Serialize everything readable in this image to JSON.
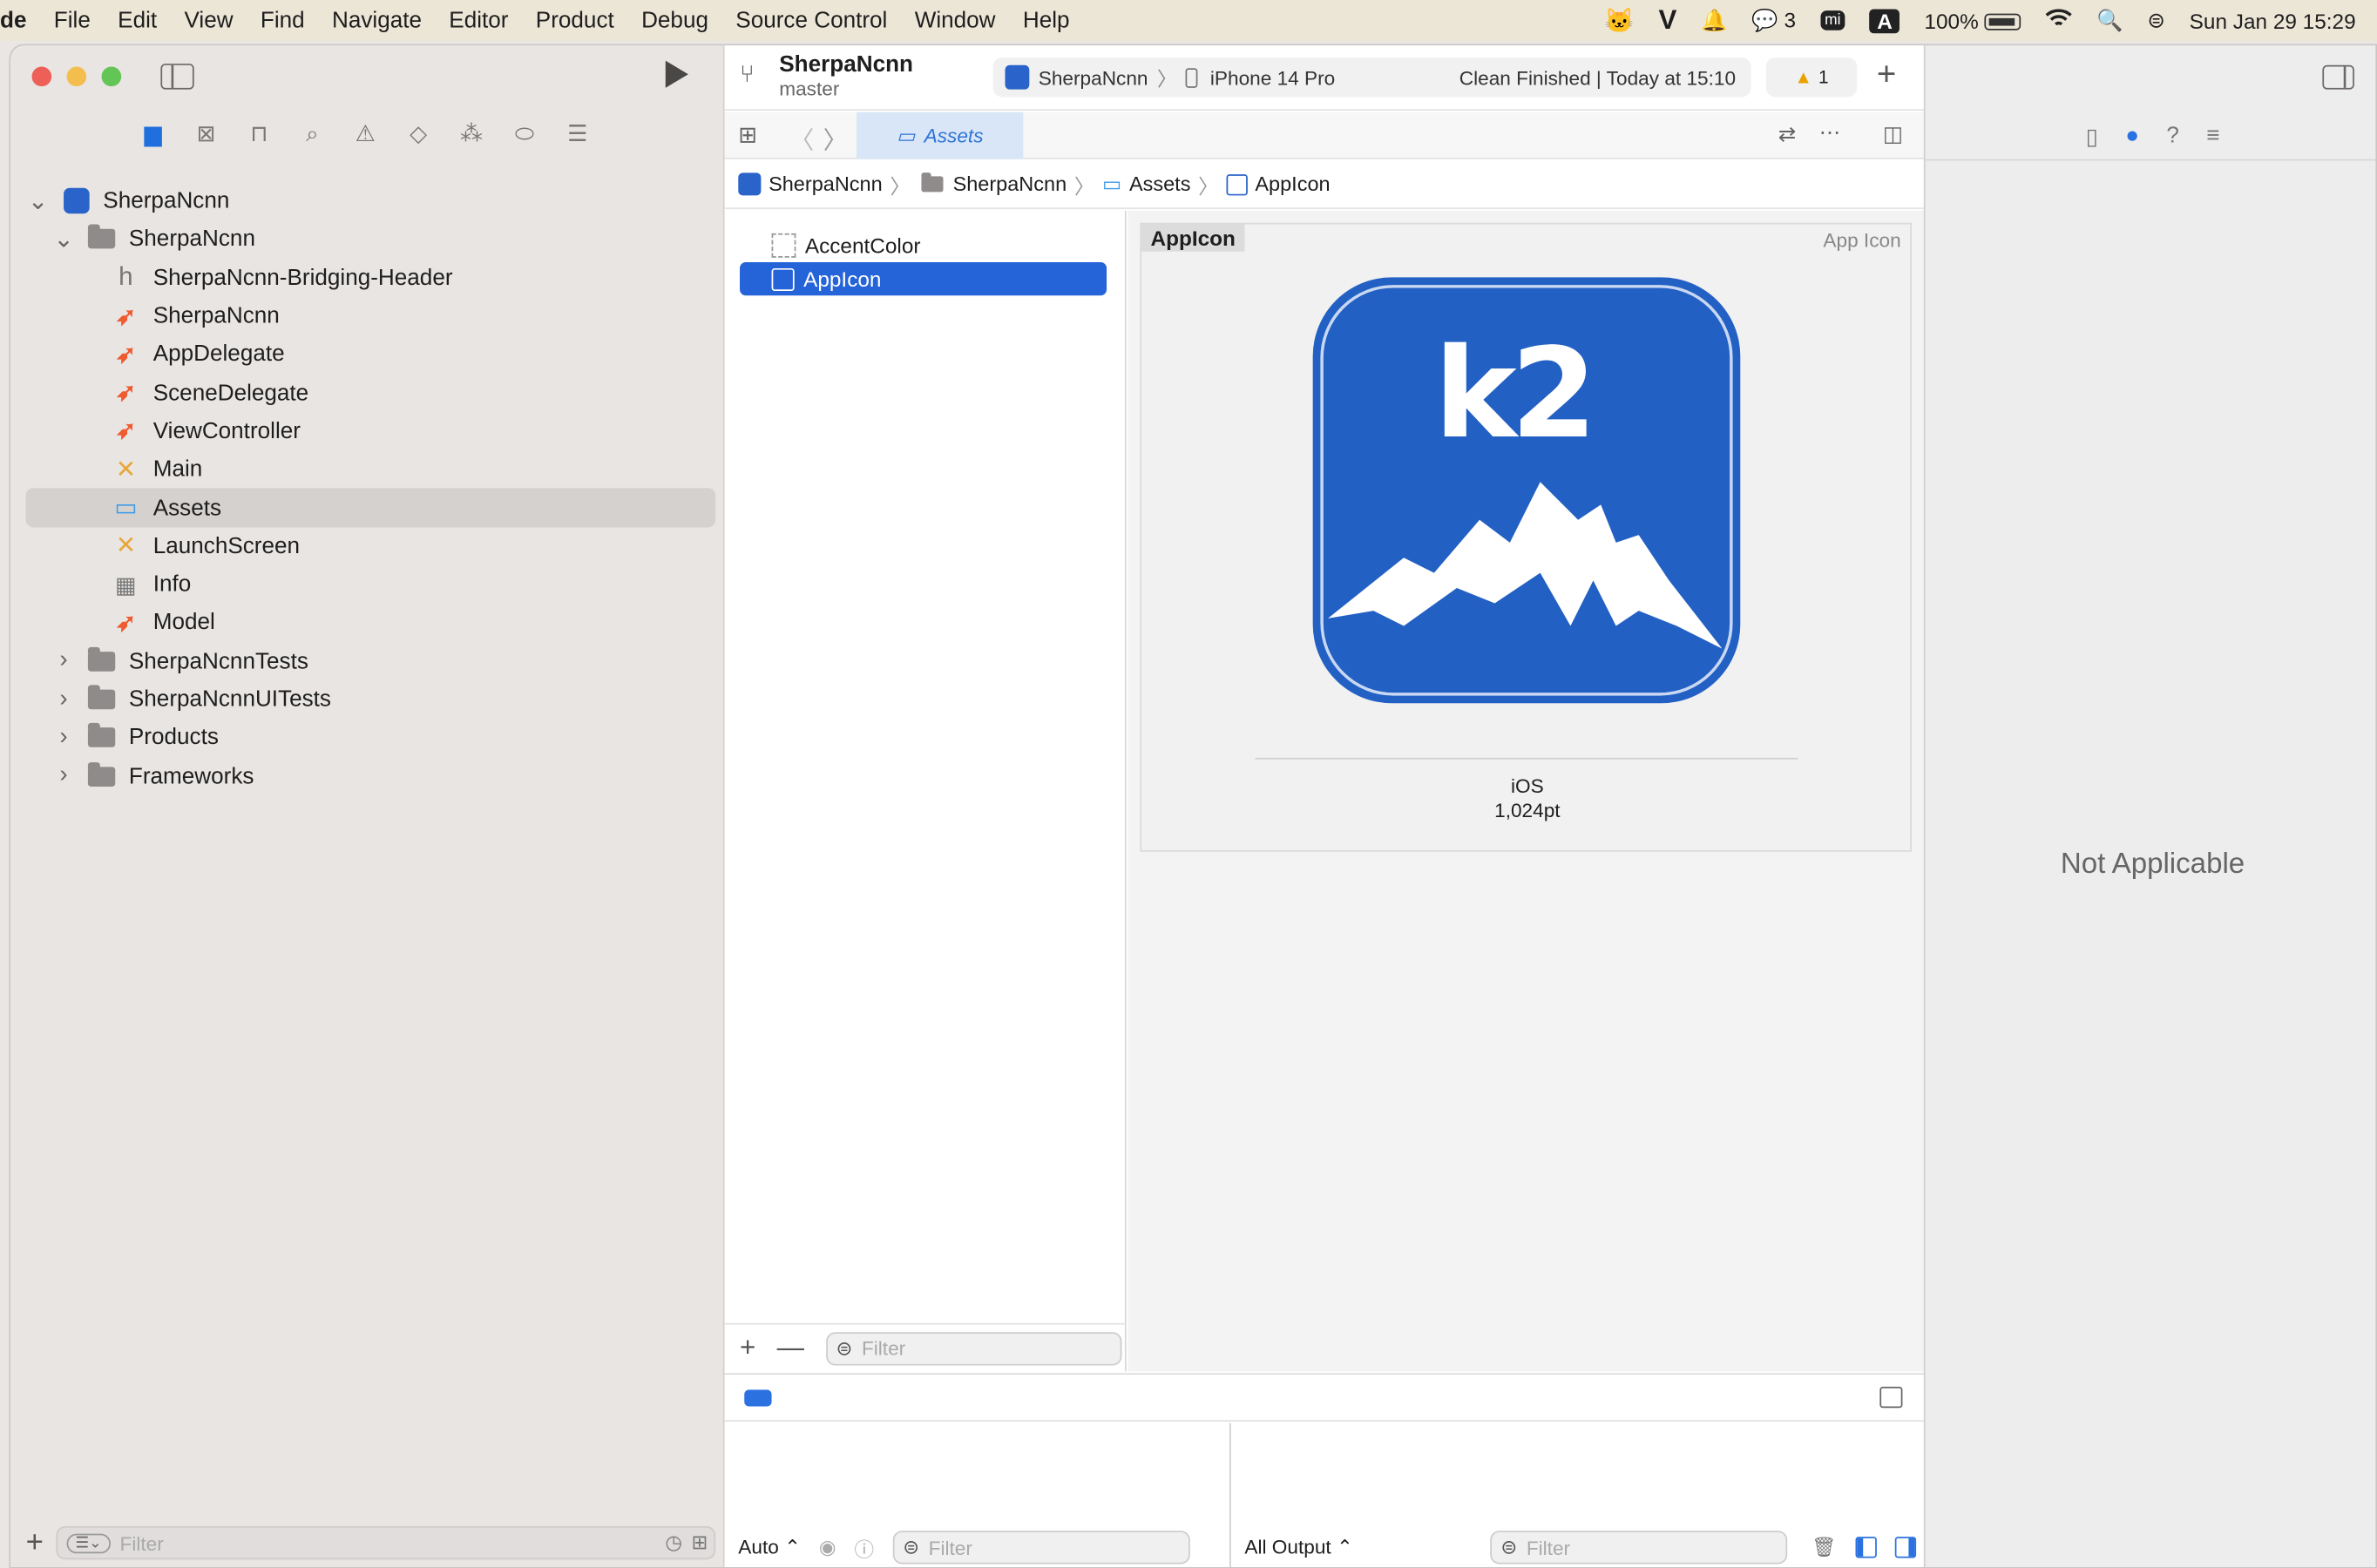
{
  "menubar": {
    "app": "de",
    "items": [
      "File",
      "Edit",
      "View",
      "Find",
      "Navigate",
      "Editor",
      "Product",
      "Debug",
      "Source Control",
      "Window",
      "Help"
    ],
    "wechat_count": "3",
    "battery": "100%",
    "ime": "A",
    "clock": "Sun Jan 29  15:29",
    "mi": "mi"
  },
  "toolbar": {
    "project": "SherpaNcnn",
    "branch": "master",
    "scheme": "SherpaNcnn",
    "device": "iPhone 14 Pro",
    "status": "Clean Finished | Today at 15:10",
    "warnings": "1"
  },
  "tab": {
    "label": "Assets"
  },
  "breadcrumb": [
    "SherpaNcnn",
    "SherpaNcnn",
    "Assets",
    "AppIcon"
  ],
  "tree": [
    {
      "label": "SherpaNcnn",
      "indent": 0,
      "disc": "v",
      "icon": "app"
    },
    {
      "label": "SherpaNcnn",
      "indent": 1,
      "disc": "v",
      "icon": "folder"
    },
    {
      "label": "SherpaNcnn-Bridging-Header",
      "indent": 2,
      "icon": "h"
    },
    {
      "label": "SherpaNcnn",
      "indent": 2,
      "icon": "swift"
    },
    {
      "label": "AppDelegate",
      "indent": 2,
      "icon": "swift"
    },
    {
      "label": "SceneDelegate",
      "indent": 2,
      "icon": "swift"
    },
    {
      "label": "ViewController",
      "indent": 2,
      "icon": "swift"
    },
    {
      "label": "Main",
      "indent": 2,
      "icon": "xib"
    },
    {
      "label": "Assets",
      "indent": 2,
      "icon": "assets",
      "selected": true
    },
    {
      "label": "LaunchScreen",
      "indent": 2,
      "icon": "xib"
    },
    {
      "label": "Info",
      "indent": 2,
      "icon": "table"
    },
    {
      "label": "Model",
      "indent": 2,
      "icon": "swift"
    },
    {
      "label": "SherpaNcnnTests",
      "indent": 1,
      "disc": ">",
      "icon": "folder"
    },
    {
      "label": "SherpaNcnnUITests",
      "indent": 1,
      "disc": ">",
      "icon": "folder"
    },
    {
      "label": "Products",
      "indent": 1,
      "disc": ">",
      "icon": "folder"
    },
    {
      "label": "Frameworks",
      "indent": 1,
      "disc": ">",
      "icon": "folder"
    }
  ],
  "assets": {
    "items": [
      {
        "label": "AccentColor"
      },
      {
        "label": "AppIcon"
      }
    ],
    "filter_placeholder": "Filter"
  },
  "appicon": {
    "title": "AppIcon",
    "kind": "App Icon",
    "platform": "iOS",
    "size": "1,024pt",
    "logo_text": "k2"
  },
  "inspector": {
    "message": "Not Applicable"
  },
  "debug": {
    "scope": "Auto ⌃",
    "filter_placeholder": "Filter",
    "output": "All Output ⌃",
    "out_filter_placeholder": "Filter"
  },
  "nav_filter": {
    "placeholder": "Filter"
  }
}
